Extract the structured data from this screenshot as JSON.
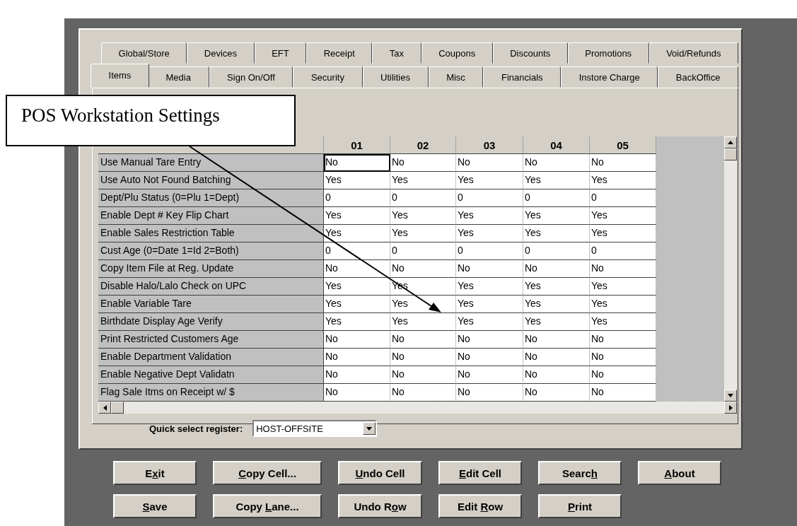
{
  "callout": {
    "text": "POS Workstation Settings"
  },
  "tabs_back": [
    {
      "label": "Global/Store",
      "selected": false
    },
    {
      "label": "Devices",
      "selected": false
    },
    {
      "label": "EFT",
      "selected": false
    },
    {
      "label": "Receipt",
      "selected": false
    },
    {
      "label": "Tax",
      "selected": false
    },
    {
      "label": "Coupons",
      "selected": false
    },
    {
      "label": "Discounts",
      "selected": false
    },
    {
      "label": "Promotions",
      "selected": false
    },
    {
      "label": "Void/Refunds",
      "selected": false
    }
  ],
  "tabs_front": [
    {
      "label": "Items",
      "selected": true
    },
    {
      "label": "Media",
      "selected": false
    },
    {
      "label": "Sign On/Off",
      "selected": false
    },
    {
      "label": "Security",
      "selected": false
    },
    {
      "label": "Utilities",
      "selected": false
    },
    {
      "label": "Misc",
      "selected": false
    },
    {
      "label": "Financials",
      "selected": false
    },
    {
      "label": "Instore Charge",
      "selected": false
    },
    {
      "label": "BackOffice",
      "selected": false
    }
  ],
  "table": {
    "columns": [
      "01",
      "02",
      "03",
      "04",
      "05"
    ],
    "rows": [
      {
        "option": "Use Manual Tare Entry",
        "cells": [
          {
            "value": "No",
            "selected": true
          },
          {
            "value": "No",
            "selected": false
          },
          {
            "value": "No",
            "selected": false
          },
          {
            "value": "No",
            "selected": false
          },
          {
            "value": "No",
            "selected": false
          }
        ]
      },
      {
        "option": "Use Auto Not Found Batching",
        "cells": [
          {
            "value": "Yes",
            "selected": false
          },
          {
            "value": "Yes",
            "selected": false
          },
          {
            "value": "Yes",
            "selected": false
          },
          {
            "value": "Yes",
            "selected": false
          },
          {
            "value": "Yes",
            "selected": false
          }
        ]
      },
      {
        "option": "Dept/Plu Status (0=Plu 1=Dept)",
        "cells": [
          {
            "value": "0",
            "selected": false
          },
          {
            "value": "0",
            "selected": false
          },
          {
            "value": "0",
            "selected": false
          },
          {
            "value": "0",
            "selected": false
          },
          {
            "value": "0",
            "selected": false
          }
        ]
      },
      {
        "option": "Enable Dept # Key Flip Chart",
        "cells": [
          {
            "value": "Yes",
            "selected": false
          },
          {
            "value": "Yes",
            "selected": false
          },
          {
            "value": "Yes",
            "selected": false
          },
          {
            "value": "Yes",
            "selected": false
          },
          {
            "value": "Yes",
            "selected": false
          }
        ]
      },
      {
        "option": "Enable Sales Restriction Table",
        "cells": [
          {
            "value": "Yes",
            "selected": false
          },
          {
            "value": "Yes",
            "selected": false
          },
          {
            "value": "Yes",
            "selected": false
          },
          {
            "value": "Yes",
            "selected": false
          },
          {
            "value": "Yes",
            "selected": false
          }
        ]
      },
      {
        "option": "Cust Age (0=Date 1=Id 2=Both)",
        "cells": [
          {
            "value": "0",
            "selected": false
          },
          {
            "value": "0",
            "selected": false
          },
          {
            "value": "0",
            "selected": false
          },
          {
            "value": "0",
            "selected": false
          },
          {
            "value": "0",
            "selected": false
          }
        ]
      },
      {
        "option": "Copy Item File at Reg. Update",
        "cells": [
          {
            "value": "No",
            "selected": false
          },
          {
            "value": "No",
            "selected": false
          },
          {
            "value": "No",
            "selected": false
          },
          {
            "value": "No",
            "selected": false
          },
          {
            "value": "No",
            "selected": false
          }
        ]
      },
      {
        "option": "Disable Halo/Lalo Check on UPC",
        "cells": [
          {
            "value": "Yes",
            "selected": false
          },
          {
            "value": "Yes",
            "selected": false
          },
          {
            "value": "Yes",
            "selected": false
          },
          {
            "value": "Yes",
            "selected": false
          },
          {
            "value": "Yes",
            "selected": false
          }
        ]
      },
      {
        "option": "Enable Variable Tare",
        "cells": [
          {
            "value": "Yes",
            "selected": false
          },
          {
            "value": "Yes",
            "selected": false
          },
          {
            "value": "Yes",
            "selected": false
          },
          {
            "value": "Yes",
            "selected": false
          },
          {
            "value": "Yes",
            "selected": false
          }
        ]
      },
      {
        "option": "Birthdate Display Age Verify",
        "cells": [
          {
            "value": "Yes",
            "selected": false
          },
          {
            "value": "Yes",
            "selected": false
          },
          {
            "value": "Yes",
            "selected": false
          },
          {
            "value": "Yes",
            "selected": false
          },
          {
            "value": "Yes",
            "selected": false
          }
        ]
      },
      {
        "option": "Print Restricted Customers Age",
        "cells": [
          {
            "value": "No",
            "selected": false
          },
          {
            "value": "No",
            "selected": false
          },
          {
            "value": "No",
            "selected": false
          },
          {
            "value": "No",
            "selected": false
          },
          {
            "value": "No",
            "selected": false
          }
        ]
      },
      {
        "option": "Enable Department Validation",
        "cells": [
          {
            "value": "No",
            "selected": false
          },
          {
            "value": "No",
            "selected": false
          },
          {
            "value": "No",
            "selected": false
          },
          {
            "value": "No",
            "selected": false
          },
          {
            "value": "No",
            "selected": false
          }
        ]
      },
      {
        "option": "Enable Negative Dept Validatn",
        "cells": [
          {
            "value": "No",
            "selected": false
          },
          {
            "value": "No",
            "selected": false
          },
          {
            "value": "No",
            "selected": false
          },
          {
            "value": "No",
            "selected": false
          },
          {
            "value": "No",
            "selected": false
          }
        ]
      },
      {
        "option": "Flag Sale Itms on Receipt w/ $",
        "cells": [
          {
            "value": "No",
            "selected": false
          },
          {
            "value": "No",
            "selected": false
          },
          {
            "value": "No",
            "selected": false
          },
          {
            "value": "No",
            "selected": false
          },
          {
            "value": "No",
            "selected": false
          }
        ]
      }
    ]
  },
  "quick_select": {
    "label": "Quick select register:",
    "value": "HOST-OFFSITE"
  },
  "buttons": [
    [
      {
        "parts": [
          {
            "text": "E",
            "underlined": false
          },
          {
            "text": "x",
            "underlined": true
          },
          {
            "text": "it",
            "underlined": false
          }
        ]
      },
      {
        "parts": [
          {
            "text": "C",
            "underlined": true
          },
          {
            "text": "opy Cell...",
            "underlined": false
          }
        ]
      },
      {
        "parts": [
          {
            "text": "U",
            "underlined": true
          },
          {
            "text": "ndo Cell",
            "underlined": false
          }
        ]
      },
      {
        "parts": [
          {
            "text": "E",
            "underlined": true
          },
          {
            "text": "dit Cell",
            "underlined": false
          }
        ]
      },
      {
        "parts": [
          {
            "text": "Searc",
            "underlined": false
          },
          {
            "text": "h",
            "underlined": true
          }
        ]
      },
      {
        "parts": [
          {
            "text": "A",
            "underlined": true
          },
          {
            "text": "bout",
            "underlined": false
          }
        ]
      }
    ],
    [
      {
        "parts": [
          {
            "text": "S",
            "underlined": true
          },
          {
            "text": "ave",
            "underlined": false
          }
        ]
      },
      {
        "parts": [
          {
            "text": "Copy ",
            "underlined": false
          },
          {
            "text": "L",
            "underlined": true
          },
          {
            "text": "ane...",
            "underlined": false
          }
        ]
      },
      {
        "parts": [
          {
            "text": "Undo R",
            "underlined": false
          },
          {
            "text": "o",
            "underlined": true
          },
          {
            "text": "w",
            "underlined": false
          }
        ]
      },
      {
        "parts": [
          {
            "text": "Edit ",
            "underlined": false
          },
          {
            "text": "R",
            "underlined": true
          },
          {
            "text": "ow",
            "underlined": false
          }
        ]
      },
      {
        "parts": [
          {
            "text": "P",
            "underlined": true
          },
          {
            "text": "rint",
            "underlined": false
          }
        ]
      }
    ]
  ]
}
